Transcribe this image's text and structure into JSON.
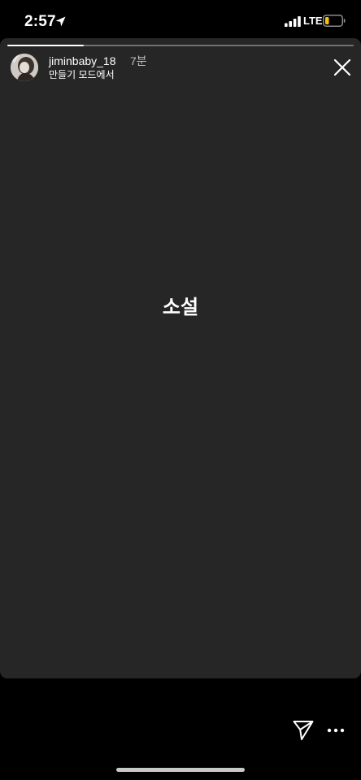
{
  "status_bar": {
    "time": "2:57",
    "network": "LTE",
    "location_icon": "location-arrow-icon",
    "signal_icon": "signal-bars-icon",
    "battery_icon": "battery-low-icon",
    "battery_color": "#f5c400"
  },
  "story": {
    "progress": 0.22,
    "username": "jiminbaby_18",
    "time_ago": "7분",
    "subtitle": "만들기 모드에서",
    "text": "소설",
    "background_color": "#262626",
    "avatar_icon": "profile-avatar",
    "close_icon": "close-icon"
  },
  "bottom_bar": {
    "share_icon": "paper-plane-icon",
    "more_icon": "more-dots-icon"
  }
}
